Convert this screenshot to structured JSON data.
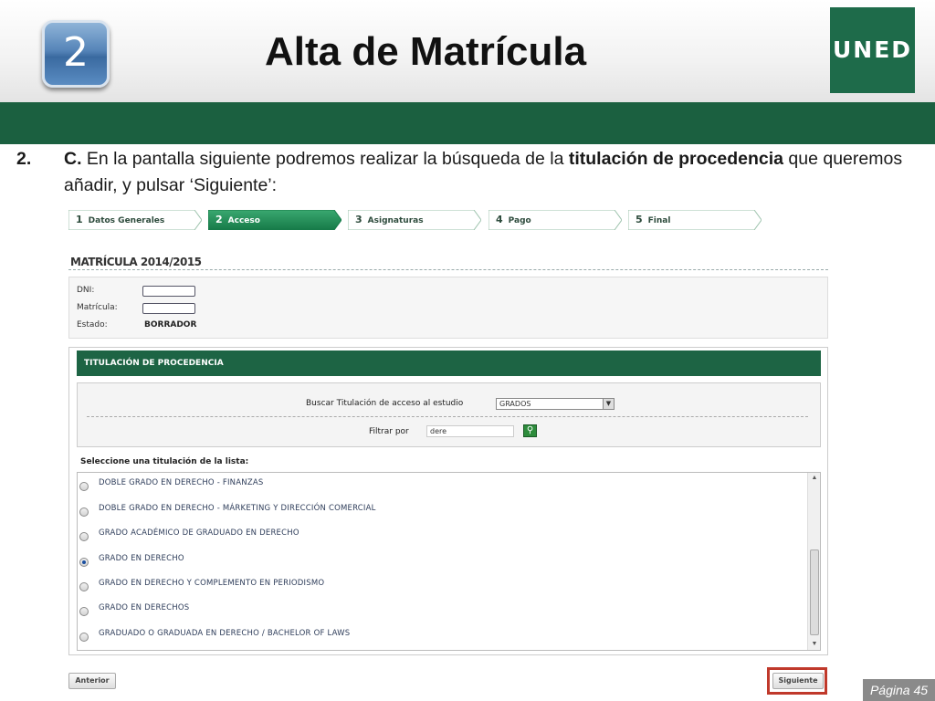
{
  "slide": {
    "step_number": "2",
    "title": "Alta de Matrícula",
    "logo_text": "UNED",
    "page_label": "Página 45"
  },
  "instruction": {
    "number": "2.",
    "prefix": "C.",
    "text_before": " En la pantalla siguiente podremos realizar la búsqueda de la ",
    "bold_text": "titulación de procedencia",
    "text_after": " que queremos añadir, y pulsar ‘Siguiente’:"
  },
  "wizard": {
    "steps": [
      {
        "number": "1",
        "label": "Datos Generales",
        "active": false
      },
      {
        "number": "2",
        "label": "Acceso",
        "active": true
      },
      {
        "number": "3",
        "label": "Asignaturas",
        "active": false
      },
      {
        "number": "4",
        "label": "Pago",
        "active": false
      },
      {
        "number": "5",
        "label": "Final",
        "active": false
      }
    ]
  },
  "form": {
    "title": "MATRÍCULA 2014/2015",
    "dni_label": "DNI:",
    "dni_value": "",
    "matricula_label": "Matrícula:",
    "matricula_value": "",
    "estado_label": "Estado:",
    "estado_value": "BORRADOR"
  },
  "titulacion": {
    "header": "TITULACIÓN DE PROCEDENCIA",
    "search_label": "Buscar Titulación de acceso al estudio",
    "search_select_value": "GRADOS",
    "filter_label": "Filtrar por",
    "filter_value": "dere",
    "list_prompt": "Seleccione una titulación de la lista:",
    "options": [
      {
        "label": "DOBLE GRADO EN DERECHO - FINANZAS",
        "checked": false
      },
      {
        "label": "DOBLE GRADO EN DERECHO - MÁRKETING Y DIRECCIÓN COMERCIAL",
        "checked": false
      },
      {
        "label": "GRADO ACADÉMICO DE GRADUADO EN DERECHO",
        "checked": false
      },
      {
        "label": "GRADO EN DERECHO",
        "checked": true
      },
      {
        "label": "GRADO EN DERECHO Y COMPLEMENTO EN PERIODISMO",
        "checked": false
      },
      {
        "label": "GRADO EN DERECHOS",
        "checked": false
      },
      {
        "label": "GRADUADO O GRADUADA EN DERECHO / BACHELOR OF LAWS",
        "checked": false
      }
    ]
  },
  "buttons": {
    "previous": "Anterior",
    "next": "Siguiente"
  },
  "colors": {
    "brand_green": "#1b6040",
    "header_green": "#1d6444",
    "highlight_red": "#c0392b",
    "badge_blue": "#4a7ab0"
  }
}
